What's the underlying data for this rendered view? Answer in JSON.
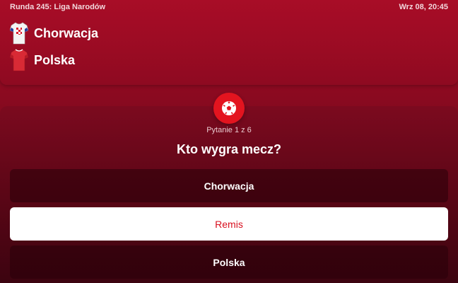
{
  "match": {
    "round_label": "Runda 245: Liga Narodów",
    "datetime": "Wrz 08, 20:45",
    "home_team": {
      "name": "Chorwacja",
      "icon": "checkered-jersey-icon"
    },
    "away_team": {
      "name": "Polska",
      "icon": "red-jersey-icon"
    }
  },
  "quiz": {
    "icon": "soccer-ball-icon",
    "counter": "Pytanie 1 z 6",
    "question": "Kto wygra mecz?",
    "options": [
      {
        "label": "Chorwacja",
        "selected": false
      },
      {
        "label": "Remis",
        "selected": true
      },
      {
        "label": "Polska",
        "selected": false
      }
    ]
  },
  "colors": {
    "background": "#8a0a20",
    "accent": "#e3141f",
    "selected_text": "#d8101f",
    "selected_bg": "#ffffff"
  }
}
